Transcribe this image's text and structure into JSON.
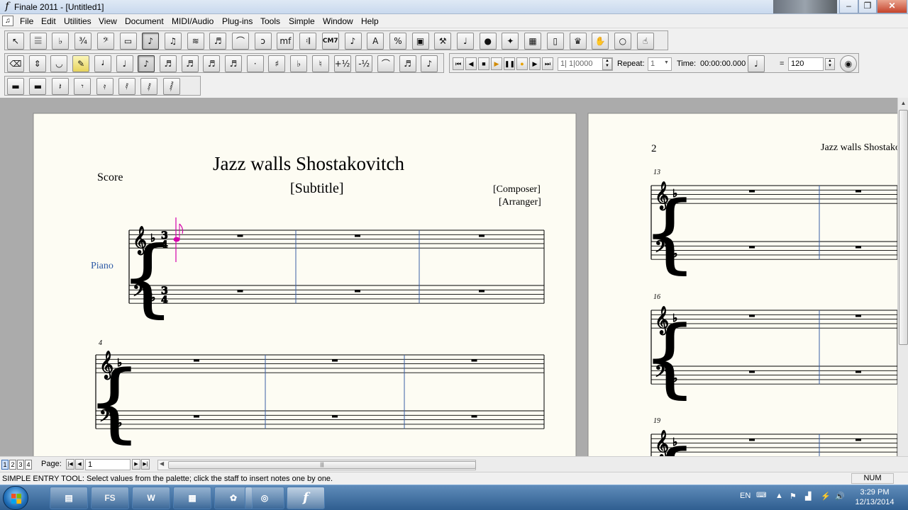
{
  "window": {
    "title": "Finale 2011 - [Untitled1]",
    "minimize": "–",
    "restore": "❐",
    "close": "✕",
    "app_icon": "finale-f-icon"
  },
  "menu": [
    "File",
    "Edit",
    "Utilities",
    "View",
    "Document",
    "MIDI/Audio",
    "Plug-ins",
    "Tools",
    "Simple",
    "Window",
    "Help"
  ],
  "main_tools": [
    {
      "name": "selection-tool-icon",
      "g": "↖"
    },
    {
      "name": "staff-tool-icon",
      "g": "𝄚"
    },
    {
      "name": "key-signature-tool-icon",
      "g": "♭"
    },
    {
      "name": "time-signature-tool-icon",
      "g": "¾"
    },
    {
      "name": "clef-tool-icon",
      "g": "𝄢"
    },
    {
      "name": "measure-tool-icon",
      "g": "▭"
    },
    {
      "name": "simple-entry-tool-icon",
      "g": "♪"
    },
    {
      "name": "speedy-entry-tool-icon",
      "g": "♫"
    },
    {
      "name": "hyperscribe-tool-icon",
      "g": "≋"
    },
    {
      "name": "tuplet-tool-icon",
      "g": "♬"
    },
    {
      "name": "smart-shape-tool-icon",
      "g": "⌒"
    },
    {
      "name": "articulation-tool-icon",
      "g": "ɔ"
    },
    {
      "name": "expression-tool-icon",
      "g": "mf"
    },
    {
      "name": "repeat-tool-icon",
      "g": "𝄇"
    },
    {
      "name": "chord-tool-icon",
      "g": "CM7"
    },
    {
      "name": "lyrics-tool-icon",
      "g": "♪"
    },
    {
      "name": "text-tool-icon",
      "g": "A"
    },
    {
      "name": "staff-styles-tool-icon",
      "g": "%"
    },
    {
      "name": "graphics-tool-icon",
      "g": "▣"
    },
    {
      "name": "special-tools-icon",
      "g": "⚒"
    },
    {
      "name": "note-mover-tool-icon",
      "g": "♩"
    },
    {
      "name": "mirror-tool-icon",
      "g": "●"
    },
    {
      "name": "midi-tool-icon",
      "g": "✦"
    },
    {
      "name": "resize-tool-icon",
      "g": "▦"
    },
    {
      "name": "page-layout-tool-icon",
      "g": "▯"
    },
    {
      "name": "studio-view-icon",
      "g": "♛"
    },
    {
      "name": "hand-grabber-tool-icon",
      "g": "✋"
    },
    {
      "name": "zoom-tool-icon",
      "g": "○"
    },
    {
      "name": "scroll-view-icon",
      "g": "☝"
    }
  ],
  "simple_tools": [
    {
      "name": "eraser-icon",
      "g": "⌫"
    },
    {
      "name": "transpose-up-down-icon",
      "g": "⇕"
    },
    {
      "name": "tie-icon",
      "g": "◡"
    },
    {
      "name": "selector-icon",
      "g": "✎"
    },
    {
      "name": "half-note-icon",
      "g": "𝅗𝅥"
    },
    {
      "name": "quarter-note-icon",
      "g": "♩"
    },
    {
      "name": "eighth-note-icon",
      "g": "♪"
    },
    {
      "name": "sixteenth-note-icon",
      "g": "♬"
    },
    {
      "name": "thirty-second-note-icon",
      "g": "♬"
    },
    {
      "name": "sixty-fourth-note-icon",
      "g": "♬"
    },
    {
      "name": "hundred-twenty-eighth-note-icon",
      "g": "♬"
    },
    {
      "name": "augmentation-dot-icon",
      "g": "·"
    },
    {
      "name": "sharp-icon",
      "g": "♯"
    },
    {
      "name": "flat-icon",
      "g": "♭"
    },
    {
      "name": "natural-icon",
      "g": "♮"
    },
    {
      "name": "half-step-up-icon",
      "g": "+½"
    },
    {
      "name": "half-step-down-icon",
      "g": "-½"
    },
    {
      "name": "tie-to-next-icon",
      "g": "⌒"
    },
    {
      "name": "tuplet-icon",
      "g": "♬"
    },
    {
      "name": "grace-note-icon",
      "g": "♪"
    }
  ],
  "playback": {
    "buttons": [
      {
        "name": "rewind-start-icon",
        "g": "⏮"
      },
      {
        "name": "step-back-icon",
        "g": "◀"
      },
      {
        "name": "stop-icon",
        "g": "■"
      },
      {
        "name": "play-icon",
        "g": "▶"
      },
      {
        "name": "pause-icon",
        "g": "❚❚"
      },
      {
        "name": "record-icon",
        "g": "●"
      },
      {
        "name": "step-forward-icon",
        "g": "▶"
      },
      {
        "name": "fast-forward-end-icon",
        "g": "⏭"
      }
    ],
    "counter": "1| 1|0000",
    "repeat_label": "Repeat:",
    "repeat_value": "1",
    "time_label": "Time:",
    "time_value": "00:00:00.000",
    "tempo_equals": "=",
    "tempo_value": "120"
  },
  "rests": [
    {
      "name": "whole-rest-icon",
      "g": "▬"
    },
    {
      "name": "half-rest-icon",
      "g": "▬"
    },
    {
      "name": "quarter-rest-icon",
      "g": "𝄽"
    },
    {
      "name": "eighth-rest-icon",
      "g": "𝄾"
    },
    {
      "name": "sixteenth-rest-icon",
      "g": "𝄿"
    },
    {
      "name": "thirty-second-rest-icon",
      "g": "𝅀"
    },
    {
      "name": "sixty-fourth-rest-icon",
      "g": "𝅁"
    },
    {
      "name": "hundred-twenty-eighth-rest-icon",
      "g": "𝅂"
    }
  ],
  "score": {
    "title": "Jazz walls Shostakovitch",
    "subtitle": "[Subtitle]",
    "composer": "[Composer]",
    "arranger": "[Arranger]",
    "part_label": "Score",
    "instrument": "Piano",
    "time_signature": "3/4",
    "page1_measure_numbers": [
      "4"
    ],
    "page2_number": "2",
    "page2_header": "Jazz walls Shostakovitch",
    "page2_measure_numbers": [
      "13",
      "16",
      "19"
    ]
  },
  "pagebar": {
    "tabs": [
      "1",
      "2",
      "3",
      "4"
    ],
    "page_label": "Page:",
    "page_value": "1"
  },
  "status": {
    "message": "SIMPLE ENTRY TOOL: Select values from the palette; click the staff to insert notes one by one.",
    "num": "NUM"
  },
  "taskbar": {
    "apps": [
      "explorer",
      "FS",
      "W",
      "launcher",
      "paint",
      "chrome",
      "finale"
    ],
    "lang": "EN",
    "time": "3:29 PM",
    "date": "12/13/2014"
  },
  "colors": {
    "selected_note": "#d400aa",
    "barline": "#3a5fa5"
  }
}
